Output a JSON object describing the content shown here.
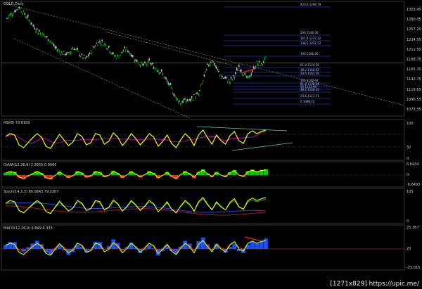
{
  "symbol_title": "GOLD,Daily",
  "watermark": "[1271x829] https://upic.me/",
  "panel_titles": {
    "rsi": "RSI(8) 73.6189",
    "osma": "OsMA(12,26,9) 2.2855 0.0000",
    "stoch": "Stoch(14,3,3) 80.0843 79.2307",
    "macd": "MACD(12,26,9) 6.849 6.335"
  },
  "price_axis": [
    "1303.45",
    "1280.05",
    "1257.20",
    "1234.55",
    "1211.50",
    "1188.75",
    "1165.70",
    "1142.75",
    "1119.65",
    "1096.55",
    "1073.35"
  ],
  "rsi_axis": [
    "100",
    "32",
    "0"
  ],
  "osma_axis": [
    "6.6434",
    "0",
    "-6.6493"
  ],
  "stoch_axis": [
    "105",
    "0"
  ],
  "macd_axis": [
    "25.367",
    "20",
    "-25.015"
  ],
  "fib_levels": [
    "423.6 1296.79",
    "200 1246.00",
    "161.8 1237.22",
    "138.2 1231.72",
    "100 1196.96",
    "61.8 1174.29",
    "38.2 1166.62",
    "23.6 1161.19",
    "100 1142.64",
    "61.8 1138.24",
    "50 1133.96",
    "38.2 1128.35",
    "23.6 1117.71",
    "0 1098.72"
  ],
  "colors": {
    "bull": "#00cc00",
    "bear": "#c8c8c8",
    "rsi": "#ffff00",
    "signal": "#ff00ff",
    "osma_pos": "#00cc00",
    "osma_neg": "#ff2200",
    "macd_hist": "#1a4dff",
    "trend": "#9aa0a0",
    "fib": "#3355ff",
    "arrow": "#ff2020"
  },
  "chart_data": {
    "type": "line",
    "title": "GOLD,Daily",
    "price_series": [
      1273,
      1284,
      1291,
      1300,
      1288,
      1276,
      1262,
      1250,
      1244,
      1236,
      1228,
      1213,
      1205,
      1201,
      1199,
      1214,
      1205,
      1194,
      1189,
      1203,
      1219,
      1227,
      1221,
      1213,
      1197,
      1193,
      1204,
      1210,
      1199,
      1187,
      1178,
      1175,
      1182,
      1172,
      1166,
      1156,
      1139,
      1124,
      1104,
      1095,
      1100,
      1098,
      1108,
      1112,
      1142,
      1172,
      1188,
      1168,
      1150,
      1146,
      1140,
      1152,
      1172,
      1158,
      1145,
      1162,
      1180,
      1176,
      1190
    ],
    "rsi_series": [
      62,
      70,
      66,
      38,
      30,
      44,
      58,
      70,
      60,
      34,
      28,
      48,
      68,
      52,
      36,
      46,
      70,
      62,
      38,
      44,
      70,
      66,
      40,
      48,
      72,
      60,
      36,
      50,
      70,
      56,
      38,
      52,
      70,
      60,
      34,
      48,
      66,
      42,
      30,
      52,
      70,
      58,
      36,
      66,
      80,
      58,
      40,
      66,
      50,
      40,
      64,
      76,
      50,
      42,
      70,
      78,
      70,
      76,
      80
    ],
    "ylim": [
      1073.35,
      1303.45
    ]
  }
}
